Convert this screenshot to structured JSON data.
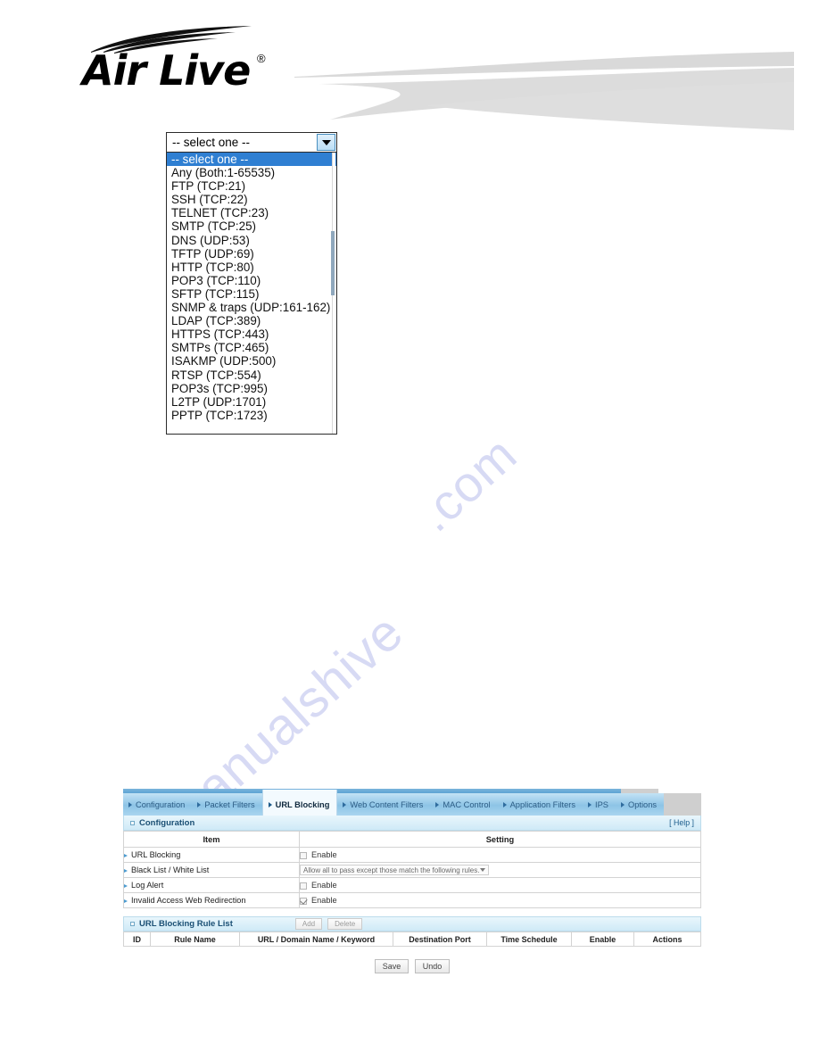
{
  "brand": {
    "name": "AirLive",
    "name_air": "Air",
    "name_live": "Live",
    "registered_mark": "®"
  },
  "watermark": {
    "line1": "manualshive",
    "line2": ".com"
  },
  "dropdown": {
    "selected_value": "-- select one --",
    "caret_icon": "chevron-down-icon",
    "options": [
      "-- select one --",
      "Any (Both:1-65535)",
      "FTP (TCP:21)",
      "SSH (TCP:22)",
      "TELNET (TCP:23)",
      "SMTP (TCP:25)",
      "DNS (UDP:53)",
      "TFTP (UDP:69)",
      "HTTP (TCP:80)",
      "POP3 (TCP:110)",
      "SFTP (TCP:115)",
      "SNMP & traps (UDP:161-162)",
      "LDAP (TCP:389)",
      "HTTPS (TCP:443)",
      "SMTPs (TCP:465)",
      "ISAKMP (UDP:500)",
      "RTSP (TCP:554)",
      "POP3s (TCP:995)",
      "L2TP (UDP:1701)",
      "PPTP (TCP:1723)"
    ],
    "selected_index": 0,
    "highlight_color": "#2f7fd2"
  },
  "router": {
    "tabs": [
      {
        "label": "Configuration",
        "active": false
      },
      {
        "label": "Packet Filters",
        "active": false
      },
      {
        "label": "URL Blocking",
        "active": true
      },
      {
        "label": "Web Content Filters",
        "active": false
      },
      {
        "label": "MAC Control",
        "active": false
      },
      {
        "label": "Application Filters",
        "active": false
      },
      {
        "label": "IPS",
        "active": false
      },
      {
        "label": "Options",
        "active": false
      }
    ],
    "configuration_panel": {
      "title": "Configuration",
      "help_label": "[ Help ]",
      "column_headers": [
        "Item",
        "Setting"
      ],
      "rows": [
        {
          "item": "URL Blocking",
          "control": "checkbox",
          "label": "Enable",
          "checked": false
        },
        {
          "item": "Black List / White List",
          "control": "select",
          "value": "Allow all to pass except those match the following rules."
        },
        {
          "item": "Log Alert",
          "control": "checkbox",
          "label": "Enable",
          "checked": false
        },
        {
          "item": "Invalid Access Web Redirection",
          "control": "checkbox",
          "label": "Enable",
          "checked": true
        }
      ]
    },
    "rule_list_panel": {
      "title": "URL Blocking Rule List",
      "add_label": "Add",
      "delete_label": "Delete",
      "column_headers": [
        "ID",
        "Rule Name",
        "URL / Domain Name / Keyword",
        "Destination Port",
        "Time Schedule",
        "Enable",
        "Actions"
      ],
      "rows": []
    },
    "footer_buttons": {
      "save_label": "Save",
      "undo_label": "Undo"
    }
  }
}
